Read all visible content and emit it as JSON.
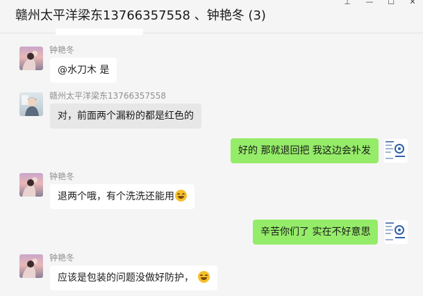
{
  "window": {
    "title": "赣州太平洋梁东13766357558 、钟艳冬 (3)",
    "controls": {
      "pin": "⊥",
      "minimize": "—",
      "maximize": "☐",
      "close": "✕"
    }
  },
  "messages": [
    {
      "sender": "钟艳冬",
      "text": "@水刀木 是",
      "direction": "in"
    },
    {
      "sender": "赣州太平洋梁东13766357558",
      "text": "对，前面两个漏粉的都是红色的",
      "direction": "in"
    },
    {
      "sender": "",
      "text": "好的 那就退回把 我这边会补发",
      "direction": "out"
    },
    {
      "sender": "钟艳冬",
      "text": "退两个哦，有个洗洗还能用",
      "emoji": "grin-sweat-emoji",
      "direction": "in"
    },
    {
      "sender": "",
      "text": "辛苦你们了 实在不好意思",
      "direction": "out"
    },
    {
      "sender": "钟艳冬",
      "text": "应该是包装的问题没做好防护，",
      "emoji": "grin-sweat-emoji",
      "direction": "in"
    }
  ],
  "colors": {
    "outgoing_bubble": "#95ec69",
    "incoming_bubble": "#ffffff",
    "background": "#f5f5f5",
    "sender_name": "#8f8f8f"
  }
}
